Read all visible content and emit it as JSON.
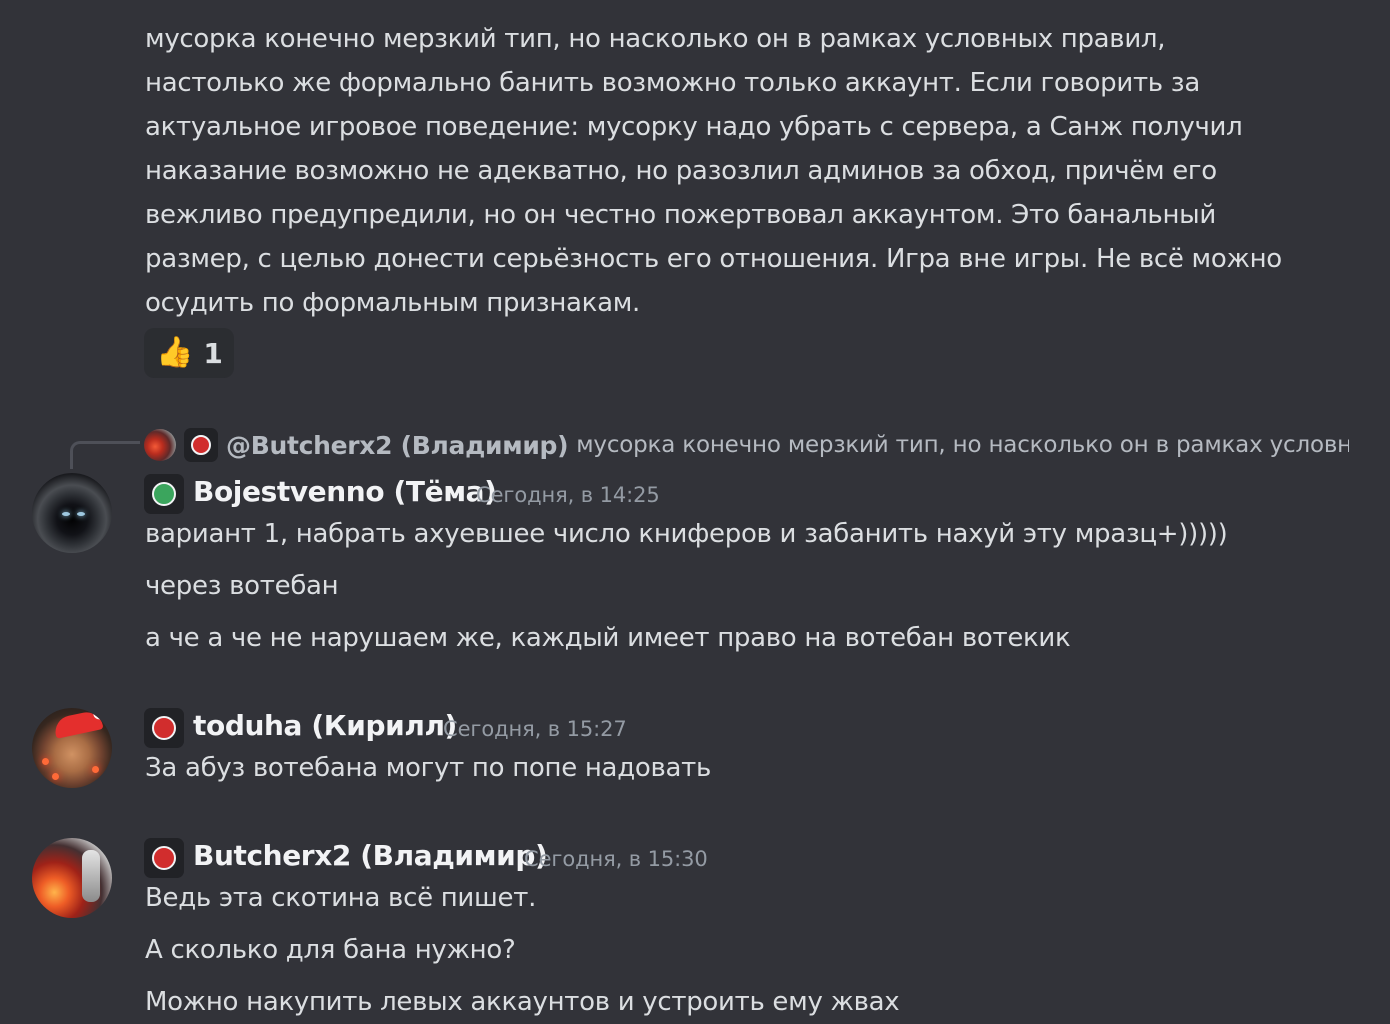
{
  "first_message": {
    "lines": [
      "мусорка конечно мерзкий тип, но насколько он в рамках условных правил,",
      "настолько же формально банить возможно только аккаунт. Если говорить за",
      "актуальное игровое поведение: мусорку надо убрать с сервера, а Санж получил",
      "наказание возможно не адекватно, но разозлил админов за обход, причём его",
      "вежливо предупредили, но он честно пожертвовал аккаунтом. Это банальный",
      "размер, с целью донести серьёзность его отношения. Игра вне игры. Не всё можно",
      "осудить по формальным признакам."
    ],
    "reaction": {
      "emoji": "👍",
      "count": "1"
    }
  },
  "reply_preview": {
    "name": "@Butcherx2 (Владимир)",
    "text": "мусорка конечно мерзкий тип, но насколько он в рамках условных"
  },
  "messages": [
    {
      "username": "Bojestvenno (Тёма)",
      "timestamp": "Сегодня, в 14:25",
      "role_color": "#3ba55d",
      "lines": [
        "вариант 1, набрать ахуевшее число книферов и забанить нахуй эту мразц+)))))",
        "через вотебан",
        "а че а че не нарушаем же, каждый имеет право на вотебан вотекик"
      ]
    },
    {
      "username": "toduha (Кирилл)",
      "timestamp": "Сегодня, в 15:27",
      "role_color": "#d12d2d",
      "lines": [
        "За абуз вотебана могут по попе надовать"
      ]
    },
    {
      "username": "Butcherx2 (Владимир)",
      "timestamp": "Сегодня, в 15:30",
      "role_color": "#d12d2d",
      "lines": [
        "Ведь эта скотина всё пишет.",
        "А сколько для бана нужно?",
        "Можно накупить левых аккаунтов и устроить ему жвах"
      ]
    }
  ]
}
